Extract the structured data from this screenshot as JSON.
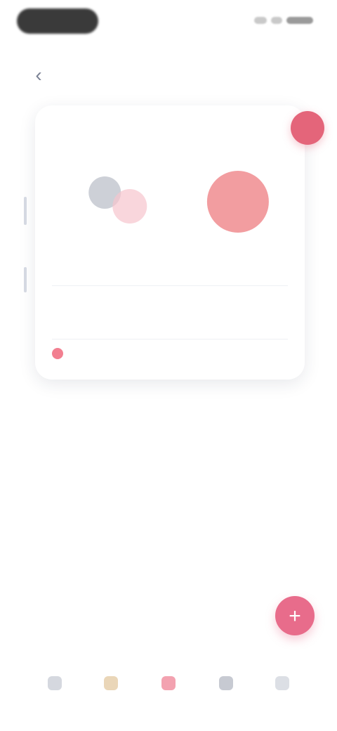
{
  "header": {
    "back_icon": "chevron-left-icon",
    "title": ""
  },
  "card": {
    "title": ""
  },
  "chart_data": {
    "type": "scatter",
    "title": "",
    "series": [
      {
        "values": [
          {
            "x": 1,
            "y": 0.6,
            "size": 0.3
          },
          {
            "x": 1.3,
            "y": 0.45,
            "size": 0.35
          },
          {
            "x": 2.6,
            "y": 0.5,
            "size": 1.0
          }
        ]
      }
    ],
    "x_tick_labels": [
      "",
      ""
    ],
    "colors": [
      "#b8bcc6",
      "#f6c4cd",
      "#f08c8f"
    ]
  },
  "rows": [
    {
      "label": "",
      "value": ""
    },
    {
      "label": "",
      "value": ""
    },
    {
      "label": "",
      "value": ""
    }
  ],
  "fab": {
    "icon": "heart-icon"
  },
  "nav": [
    {
      "label": "",
      "icon": "home-icon"
    },
    {
      "label": "",
      "icon": "chart-icon"
    },
    {
      "label": "",
      "icon": "calendar-icon"
    },
    {
      "label": "",
      "icon": "list-icon"
    },
    {
      "label": "",
      "icon": "settings-icon"
    }
  ],
  "colors": {
    "accent": "#e86c8b",
    "title": "#1b2546"
  }
}
